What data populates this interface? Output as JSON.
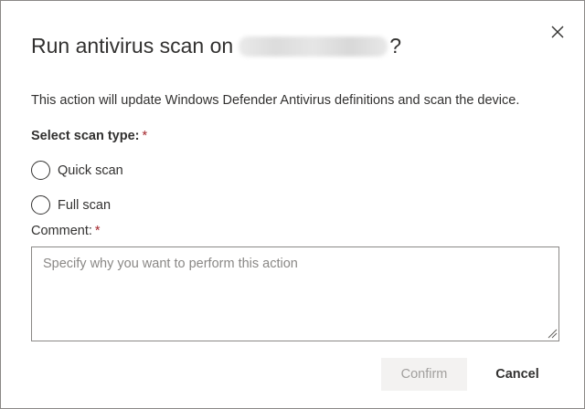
{
  "dialog": {
    "title_prefix": "Run antivirus scan on",
    "title_suffix": "?",
    "description": "This action will update Windows Defender Antivirus definitions and scan the device.",
    "scan_type_label": "Select scan type:",
    "required_marker": "*",
    "options": [
      {
        "label": "Quick scan",
        "selected": false
      },
      {
        "label": "Full scan",
        "selected": false
      }
    ],
    "comment_label": "Comment:",
    "comment_placeholder": "Specify why you want to perform this action",
    "comment_value": "",
    "confirm_label": "Confirm",
    "confirm_enabled": false,
    "cancel_label": "Cancel"
  },
  "icons": {
    "close": "close-icon",
    "resize": "resize-grip-icon"
  },
  "colors": {
    "required": "#a4262c",
    "text": "#323130",
    "disabled_text": "#a19f9d",
    "disabled_bg": "#f3f2f1"
  }
}
